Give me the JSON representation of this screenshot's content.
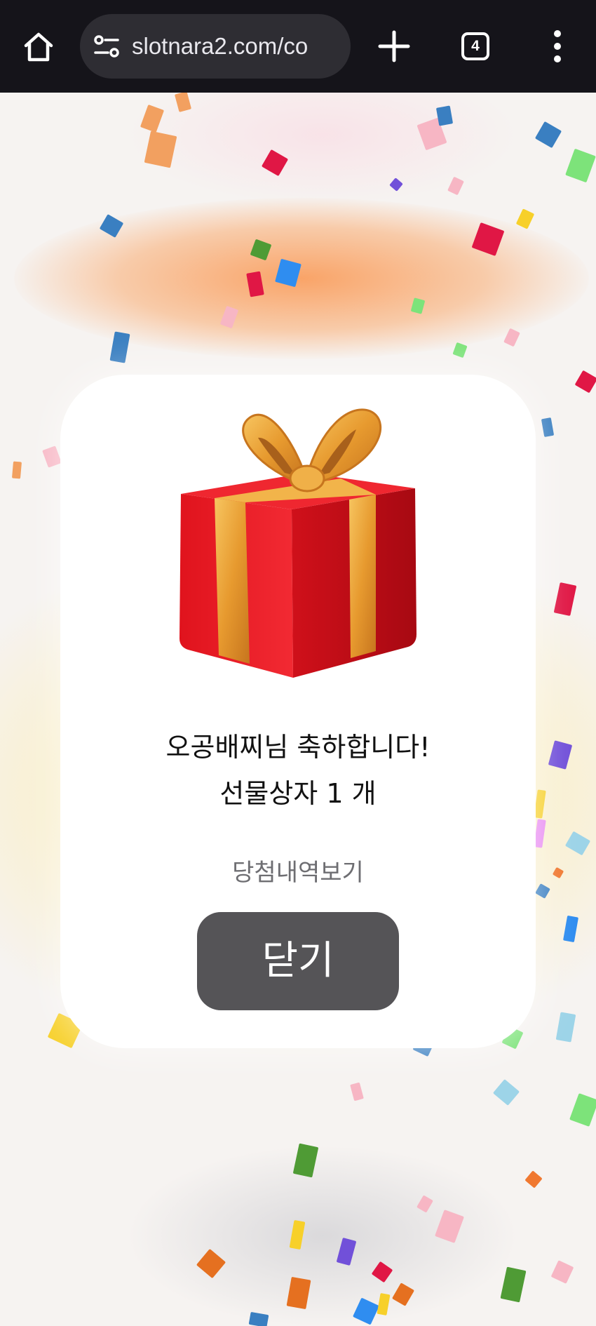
{
  "browser": {
    "url": "slotnara2.com/co",
    "tab_count": "4",
    "icons": [
      "home-icon",
      "site-settings-icon",
      "new-tab-icon",
      "tab-switcher-icon",
      "more-menu-icon"
    ]
  },
  "dialog": {
    "congrats_text": "오공배찌님 축하합니다!",
    "prize_text": "선물상자 1 개",
    "history_link": "당첨내역보기",
    "close_label": "닫기",
    "image": "gift-box"
  },
  "colors": {
    "chrome_bg": "#15141a",
    "omnibox_bg": "#2e2d33",
    "close_button": "#555457",
    "gift_red": "#e3101e",
    "ribbon_gold": "#e9a034"
  }
}
